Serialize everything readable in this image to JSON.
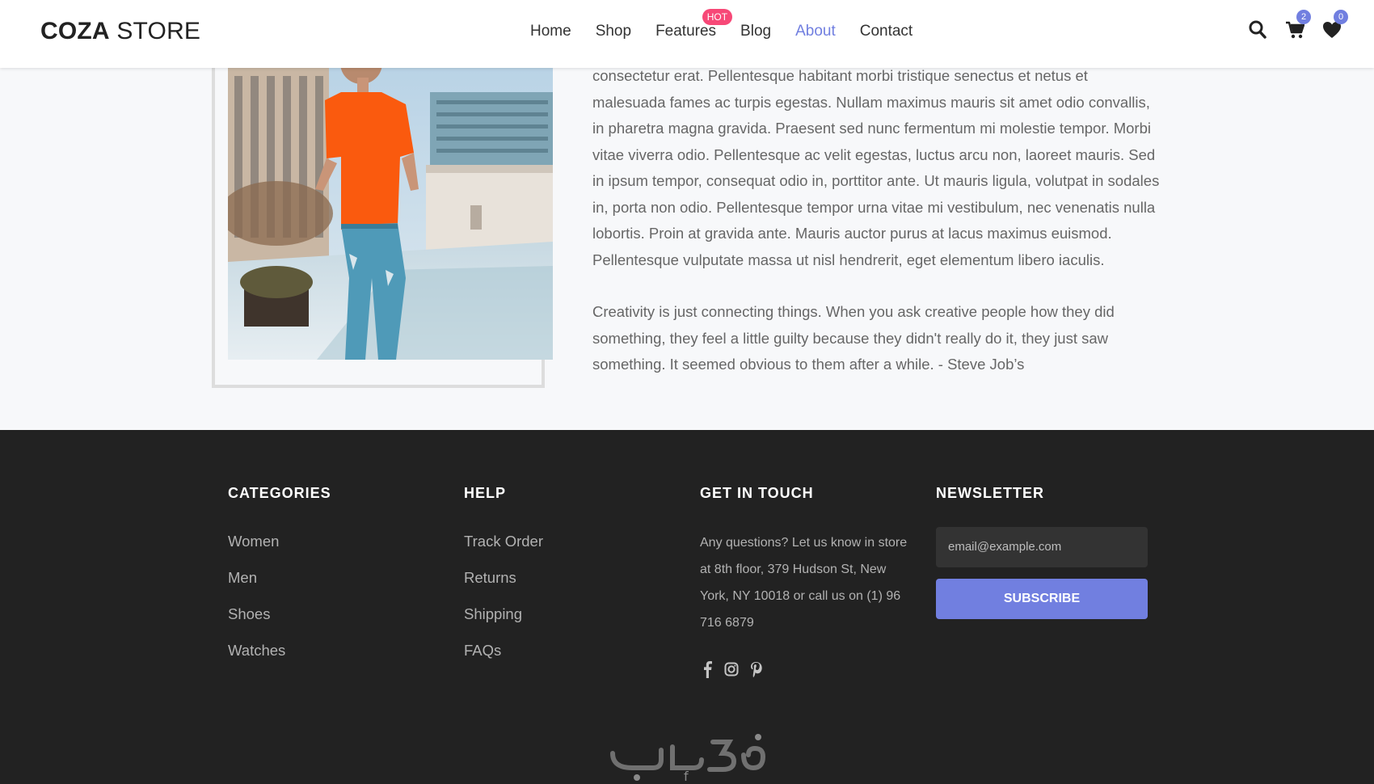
{
  "header": {
    "logo": {
      "bold": "COZA",
      "regular": "STORE"
    },
    "nav": [
      {
        "label": "Home"
      },
      {
        "label": "Shop"
      },
      {
        "label": "Features",
        "badge": "HOT"
      },
      {
        "label": "Blog"
      },
      {
        "label": "About",
        "active": true
      },
      {
        "label": "Contact"
      }
    ],
    "icons": {
      "search": "search-icon",
      "cart": {
        "icon": "cart-icon",
        "count": "2"
      },
      "wishlist": {
        "icon": "heart-icon",
        "count": "0"
      }
    }
  },
  "about": {
    "paragraph1": "consectetur erat. Pellentesque habitant morbi tristique senectus et netus et malesuada fames ac turpis egestas. Nullam maximus mauris sit amet odio convallis, in pharetra magna gravida. Praesent sed nunc fermentum mi molestie tempor. Morbi vitae viverra odio. Pellentesque ac velit egestas, luctus arcu non, laoreet mauris. Sed in ipsum tempor, consequat odio in, porttitor ante. Ut mauris ligula, volutpat in sodales in, porta non odio. Pellentesque tempor urna vitae mi vestibulum, nec venenatis nulla lobortis. Proin at gravida ante. Mauris auctor purus at lacus maximus euismod. Pellentesque vulputate massa ut nisl hendrerit, eget elementum libero iaculis.",
    "quote": "Creativity is just connecting things. When you ask creative people how they did something, they feel a little guilty because they didn't really do it, they just saw something. It seemed obvious to them after a while. - Steve Job’s"
  },
  "footer": {
    "categories": {
      "title": "CATEGORIES",
      "items": [
        "Women",
        "Men",
        "Shoes",
        "Watches"
      ]
    },
    "help": {
      "title": "HELP",
      "items": [
        "Track Order",
        "Returns",
        "Shipping",
        "FAQs"
      ]
    },
    "touch": {
      "title": "GET IN TOUCH",
      "text": "Any questions? Let us know in store at 8th floor, 379 Hudson St, New York, NY 10018 or call us on (1) 96 716 6879",
      "social": [
        "facebook-icon",
        "instagram-icon",
        "pinterest-icon"
      ]
    },
    "newsletter": {
      "title": "NEWSLETTER",
      "placeholder": "email@example.com",
      "button": "SUBSCRIBE"
    }
  },
  "colors": {
    "accent": "#717fe0",
    "hot": "#f74877",
    "footer_bg": "#222222"
  }
}
